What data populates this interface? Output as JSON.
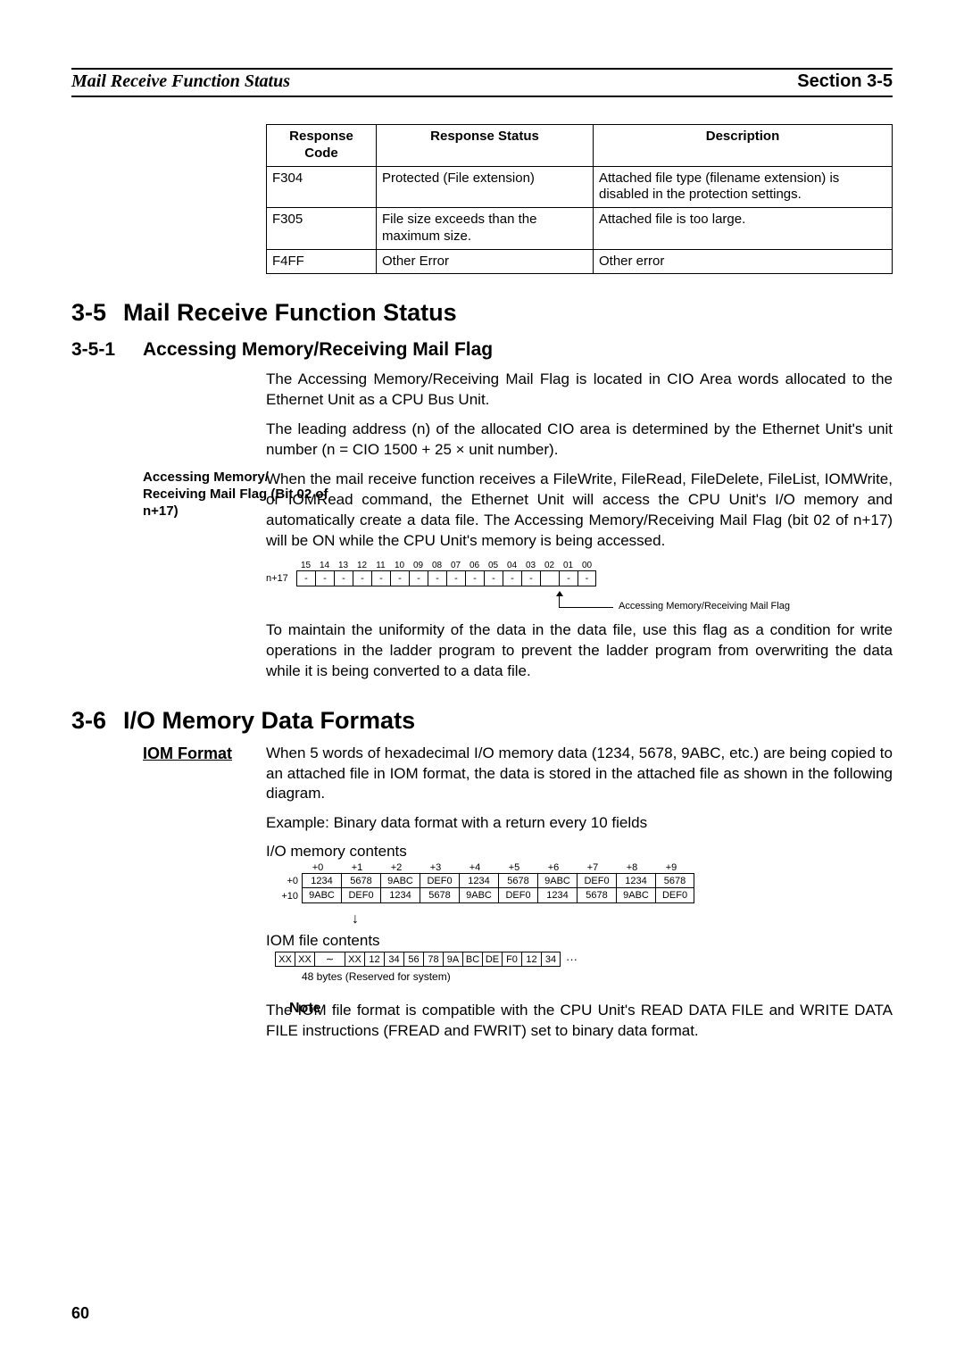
{
  "header": {
    "left": "Mail Receive Function Status",
    "right": "Section 3-5"
  },
  "response_table": {
    "headers": {
      "code": "Response Code",
      "status": "Response Status",
      "desc": "Description"
    },
    "rows": [
      {
        "code": "F304",
        "status": "Protected (File extension)",
        "desc": "Attached file type (filename extension) is disabled in the protection settings."
      },
      {
        "code": "F305",
        "status": "File size exceeds than the maximum size.",
        "desc": "Attached file is too large."
      },
      {
        "code": "F4FF",
        "status": "Other Error",
        "desc": "Other error"
      }
    ]
  },
  "sec35": {
    "num": "3-5",
    "title": "Mail Receive Function Status"
  },
  "sec351": {
    "num": "3-5-1",
    "title": "Accessing Memory/Receiving Mail Flag",
    "p1": "The Accessing Memory/Receiving Mail Flag is located in CIO Area words allocated to the Ethernet Unit as a CPU Bus Unit.",
    "p2": "The leading address (n) of the allocated CIO area is determined by the Ethernet Unit's unit number (n = CIO 1500 + 25 × unit number).",
    "sidehead": "Accessing Memory/ Receiving Mail Flag (Bit 02 of n+17)",
    "p3": "When the mail receive function receives a FileWrite, FileRead, FileDelete, FileList, IOMWrite, or IOMRead command, the Ethernet Unit will access the CPU Unit's I/O memory and automatically create a data file. The Accessing Memory/Receiving Mail Flag (bit 02 of n+17) will be ON while the CPU Unit's memory is being accessed.",
    "bits": {
      "label": "n+17",
      "nums": [
        "15",
        "14",
        "13",
        "12",
        "11",
        "10",
        "09",
        "08",
        "07",
        "06",
        "05",
        "04",
        "03",
        "02",
        "01",
        "00"
      ],
      "cells": [
        "-",
        "-",
        "-",
        "-",
        "-",
        "-",
        "-",
        "-",
        "-",
        "-",
        "-",
        "-",
        "-",
        "",
        "-",
        "-"
      ],
      "callout": "Accessing Memory/Receiving Mail Flag"
    },
    "p4": "To maintain the uniformity of the data in the data file, use this flag as a condition for write operations in the ladder program to prevent the ladder program from overwriting the data while it is being converted to a data file."
  },
  "sec36": {
    "num": "3-6",
    "title": "I/O Memory Data Formats",
    "iom_head": "IOM Format",
    "p1": "When 5 words of hexadecimal I/O memory data (1234, 5678, 9ABC, etc.) are being copied to an attached file in IOM format, the data is stored in the attached file as shown in the following diagram.",
    "p2": "Example: Binary data format with a return every 10 fields",
    "mem_title": "I/O memory contents",
    "offsets": [
      "+0",
      "+1",
      "+2",
      "+3",
      "+4",
      "+5",
      "+6",
      "+7",
      "+8",
      "+9"
    ],
    "row0_label": "+0",
    "row0": [
      "1234",
      "5678",
      "9ABC",
      "DEF0",
      "1234",
      "5678",
      "9ABC",
      "DEF0",
      "1234",
      "5678"
    ],
    "row1_label": "+10",
    "row1": [
      "9ABC",
      "DEF0",
      "1234",
      "5678",
      "9ABC",
      "DEF0",
      "1234",
      "5678",
      "9ABC",
      "DEF0"
    ],
    "iom_title": "IOM file contents",
    "iom_cells": [
      "XX",
      "XX",
      "∼",
      "XX",
      "12",
      "34",
      "56",
      "78",
      "9A",
      "BC",
      "DE",
      "F0",
      "12",
      "34"
    ],
    "iom_dots": "···",
    "reserved": "48 bytes (Reserved for system)",
    "note_label": "Note",
    "note_body": "The IOM file format is compatible with the CPU Unit's READ DATA FILE and WRITE DATA FILE instructions (FREAD and FWRIT) set to binary data format."
  },
  "page_number": "60"
}
